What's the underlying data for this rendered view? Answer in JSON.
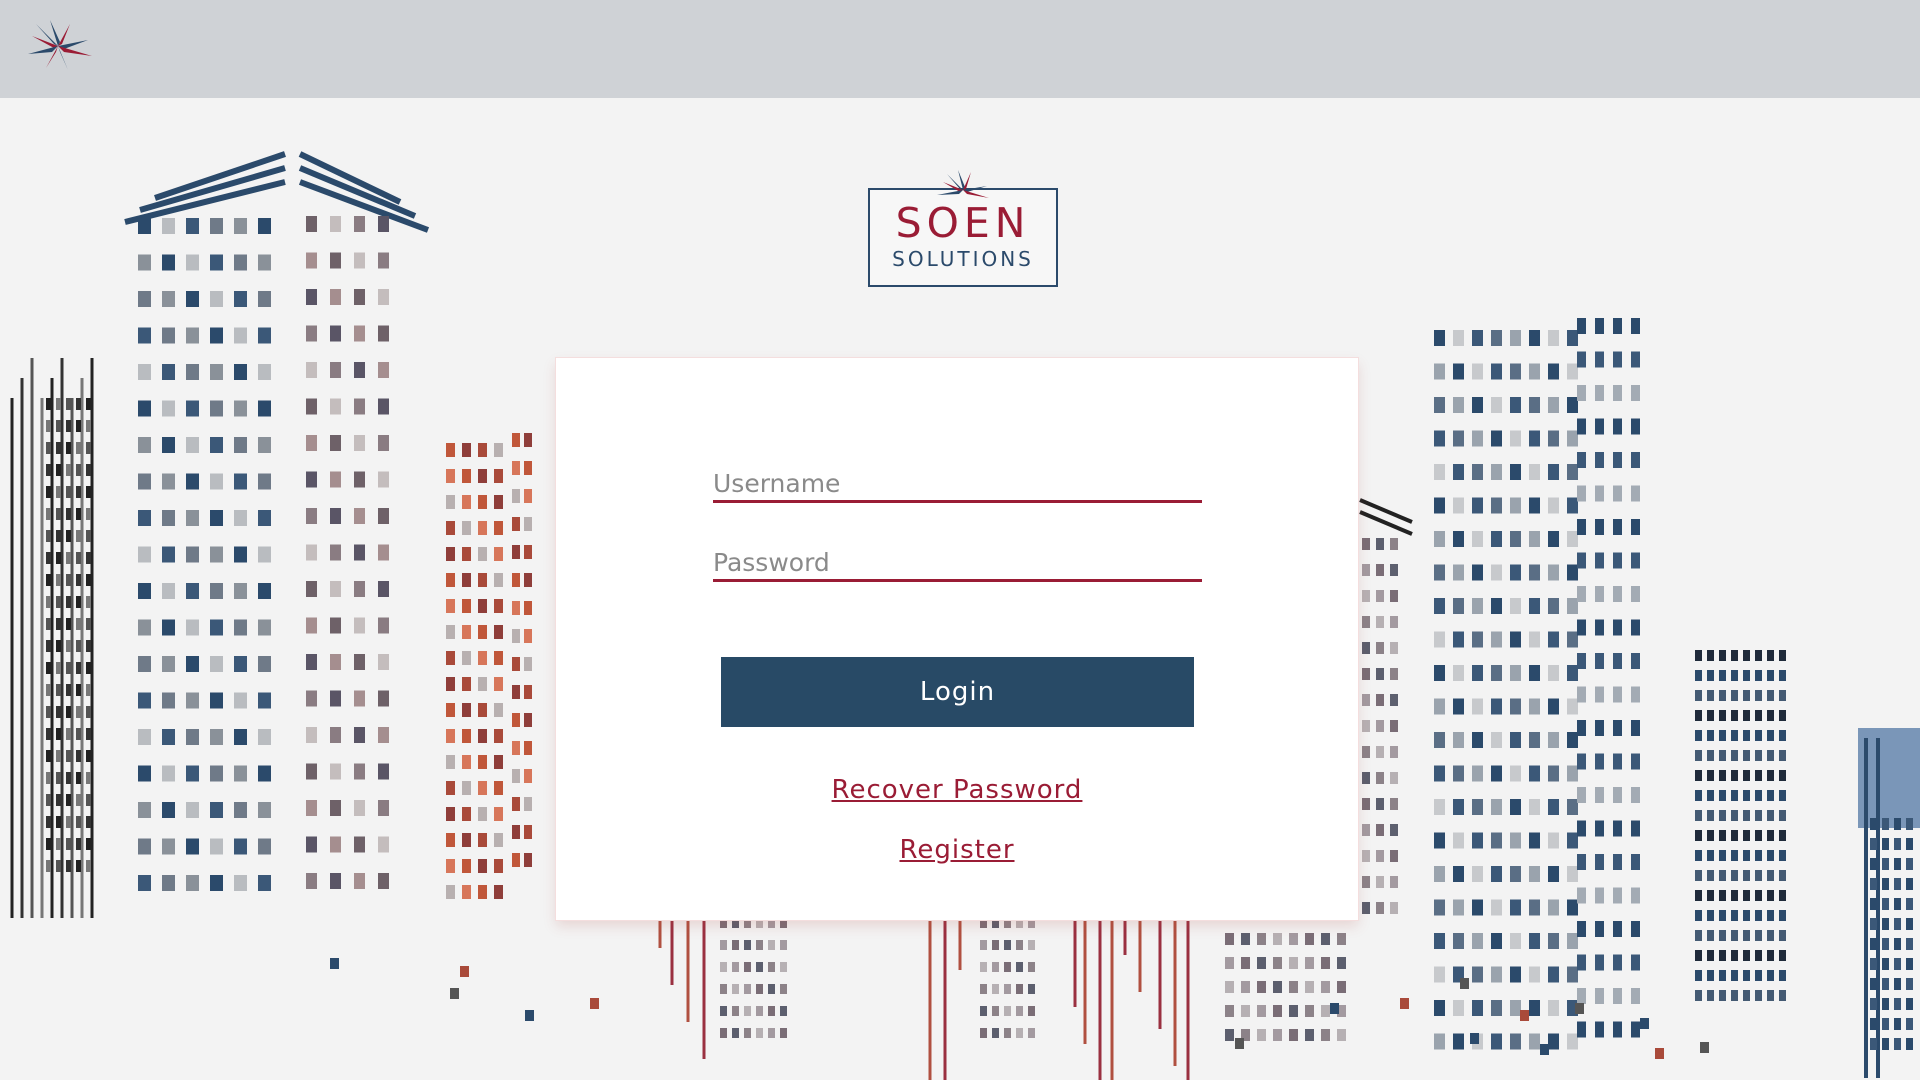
{
  "colors": {
    "accent_red": "#9a1c35",
    "navy": "#284a66",
    "topbar": "#cfd2d6",
    "background": "#f3f3f3"
  },
  "header": {
    "logo_icon": "soen-burst-logo-icon"
  },
  "brand": {
    "name": "SOEN",
    "subtitle": "SOLUTIONS"
  },
  "login": {
    "username_placeholder": "Username",
    "password_placeholder": "Password",
    "login_label": "Login",
    "recover_label": "Recover Password",
    "register_label": "Register"
  }
}
